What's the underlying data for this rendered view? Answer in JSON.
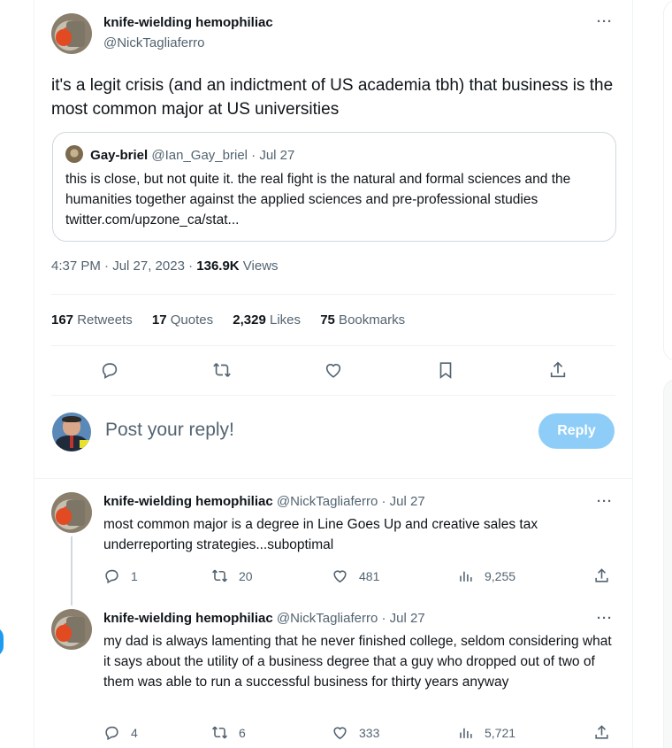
{
  "main_tweet": {
    "author_name": "knife-wielding hemophiliac",
    "author_handle": "@NickTagliaferro",
    "text": "it's a legit crisis (and an indictment of US academia tbh) that business is the most common major at US universities",
    "more_label": "···",
    "quote": {
      "author_name": "Gay-briel",
      "author_handle": "@Ian_Gay_briel",
      "date": "· Jul 27",
      "text": "this is close, but not quite it. the real fight is the natural and formal sciences and the humanities together against the applied sciences and pre-professional studies twitter.com/upzone_ca/stat..."
    },
    "timestamp": "4:37 PM · Jul 27, 2023 · ",
    "views_count": "136.9K",
    "views_label": " Views",
    "stats": {
      "retweets_count": "167",
      "retweets_label": " Retweets",
      "quotes_count": "17",
      "quotes_label": " Quotes",
      "likes_count": "2,329",
      "likes_label": " Likes",
      "bookmarks_count": "75",
      "bookmarks_label": " Bookmarks"
    }
  },
  "composer": {
    "placeholder": "Post your reply!",
    "reply_button": "Reply"
  },
  "replies": [
    {
      "author_name": "knife-wielding hemophiliac",
      "author_handle": "@NickTagliaferro",
      "date": "· Jul 27",
      "text": "most common major is a degree in Line Goes Up and creative sales tax underreporting strategies...suboptimal",
      "replies": "1",
      "retweets": "20",
      "likes": "481",
      "views": "9,255"
    },
    {
      "author_name": "knife-wielding hemophiliac",
      "author_handle": "@NickTagliaferro",
      "date": "· Jul 27",
      "text": "my dad is always lamenting that he never finished college, seldom considering what it says about the utility of a business degree that a guy who dropped out of two of them was able to run a successful business for thirty years anyway",
      "replies": "4",
      "retweets": "6",
      "likes": "333",
      "views": "5,721"
    }
  ],
  "colors": {
    "accent": "#1d9bf0",
    "reply_button_disabled": "#8ecdf8",
    "secondary_text": "#536471",
    "border": "#cfd9de"
  }
}
